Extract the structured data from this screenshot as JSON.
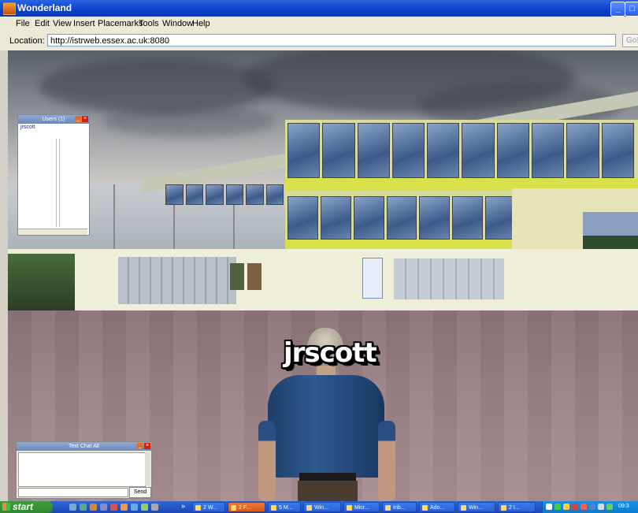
{
  "window": {
    "title": "Wonderland",
    "btn_min": "_",
    "btn_max": "□",
    "btn_close": "×"
  },
  "menu": [
    "File",
    "Edit",
    "View",
    "Insert",
    "Placemarks",
    "Tools",
    "Window",
    "Help"
  ],
  "location": {
    "label": "Location:",
    "value": "http://istrweb.essex.ac.uk:8080",
    "go_label": "Go!"
  },
  "users_panel": {
    "title": "Users (1)",
    "users": [
      "jrscott"
    ]
  },
  "chat_panel": {
    "title": "Text Chat All",
    "send_label": "Send"
  },
  "avatar_nametag": "jrscott",
  "taskbar": {
    "start_label": "start",
    "quicklaunch_more": "»",
    "tasks": [
      "2 W...",
      "2 F...",
      "5 M...",
      "Win...",
      "Micr...",
      "Inb...",
      "Ado...",
      "Win...",
      "2 I..."
    ],
    "clock": "09:3"
  },
  "colors": {
    "titlebar": "#0b3fc8",
    "taskbar": "#2456c4",
    "start": "#2f8a2f",
    "ground": "#9a8286"
  }
}
